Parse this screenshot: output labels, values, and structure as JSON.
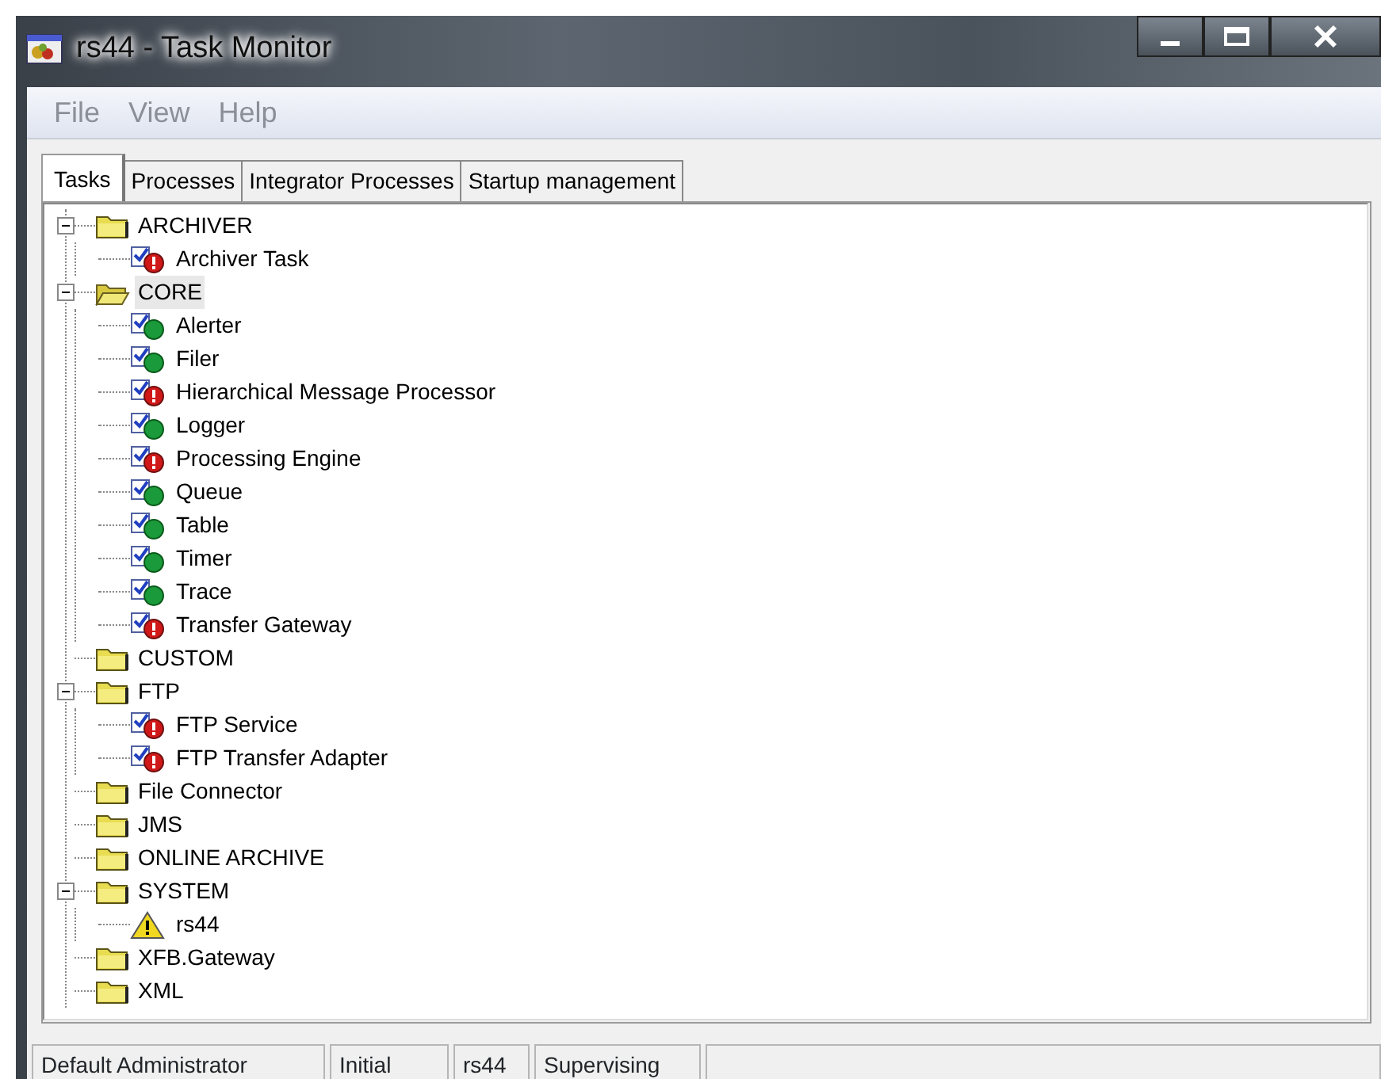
{
  "window": {
    "title": "rs44 - Task Monitor"
  },
  "menu": [
    "File",
    "View",
    "Help"
  ],
  "tabs": [
    {
      "label": "Tasks",
      "selected": true
    },
    {
      "label": "Processes",
      "selected": false
    },
    {
      "label": "Integrator Processes",
      "selected": false
    },
    {
      "label": "Startup management",
      "selected": false
    }
  ],
  "tree": [
    {
      "label": "ARCHIVER",
      "kind": "folder",
      "expanded": true,
      "selected": false,
      "children": [
        {
          "label": "Archiver Task",
          "kind": "error"
        }
      ]
    },
    {
      "label": "CORE",
      "kind": "folder",
      "expanded": true,
      "selected": true,
      "children": [
        {
          "label": "Alerter",
          "kind": "ok"
        },
        {
          "label": "Filer",
          "kind": "ok"
        },
        {
          "label": "Hierarchical Message Processor",
          "kind": "error"
        },
        {
          "label": "Logger",
          "kind": "ok"
        },
        {
          "label": "Processing Engine",
          "kind": "error"
        },
        {
          "label": "Queue",
          "kind": "ok"
        },
        {
          "label": "Table",
          "kind": "ok"
        },
        {
          "label": "Timer",
          "kind": "ok"
        },
        {
          "label": "Trace",
          "kind": "ok"
        },
        {
          "label": "Transfer Gateway",
          "kind": "error"
        }
      ]
    },
    {
      "label": "CUSTOM",
      "kind": "folder",
      "expanded": false,
      "selected": false
    },
    {
      "label": "FTP",
      "kind": "folder",
      "expanded": true,
      "selected": false,
      "children": [
        {
          "label": "FTP Service",
          "kind": "error"
        },
        {
          "label": "FTP Transfer Adapter",
          "kind": "error"
        }
      ]
    },
    {
      "label": "File Connector",
      "kind": "folder",
      "expanded": false,
      "selected": false
    },
    {
      "label": "JMS",
      "kind": "folder",
      "expanded": false,
      "selected": false
    },
    {
      "label": "ONLINE ARCHIVE",
      "kind": "folder",
      "expanded": false,
      "selected": false
    },
    {
      "label": "SYSTEM",
      "kind": "folder",
      "expanded": true,
      "selected": false,
      "children": [
        {
          "label": "rs44",
          "kind": "warning"
        }
      ]
    },
    {
      "label": "XFB.Gateway",
      "kind": "folder",
      "expanded": false,
      "selected": false
    },
    {
      "label": "XML",
      "kind": "folder",
      "expanded": false,
      "selected": false
    }
  ],
  "status_bar": [
    "Default Administrator",
    "Initial",
    "rs44",
    "Supervising"
  ]
}
